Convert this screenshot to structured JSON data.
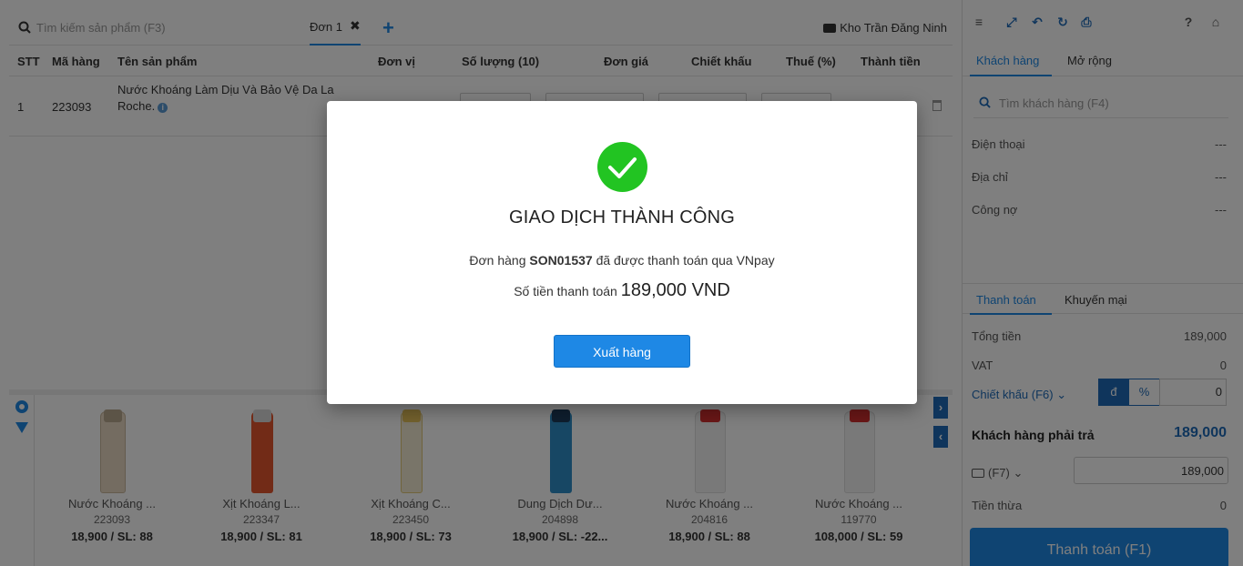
{
  "search": {
    "placeholder": "Tìm kiếm sản phẩm (F3)"
  },
  "order_tab": {
    "label": "Đơn 1",
    "close": "✖",
    "add": "+"
  },
  "warehouse": "Kho Trần Đăng Ninh",
  "table": {
    "headers": [
      "STT",
      "Mã hàng",
      "Tên sản phẩm",
      "Đơn vị",
      "Số lượng (10)",
      "Đơn giá",
      "Chiết khấu",
      "Thuế (%)",
      "Thành tiền"
    ],
    "rows": [
      {
        "stt": "1",
        "code": "223093",
        "name_line1": "Nước Khoáng Làm Dịu Và Bảo Vệ Da La",
        "name_line2": "Roche."
      }
    ]
  },
  "products": [
    {
      "name": "Nước Khoáng ...",
      "code": "223093",
      "price": "18,900 / SL: 88"
    },
    {
      "name": "Xịt Khoáng L...",
      "code": "223347",
      "price": "18,900 / SL: 81"
    },
    {
      "name": "Xịt Khoáng C...",
      "code": "223450",
      "price": "18,900 / SL: 73"
    },
    {
      "name": "Dung Dịch Dư...",
      "code": "204898",
      "price": "18,900 / SL: -22..."
    },
    {
      "name": "Nước Khoáng ...",
      "code": "204816",
      "price": "18,900 / SL: 88"
    },
    {
      "name": "Nước Khoáng ...",
      "code": "119770",
      "price": "108,000 / SL: 59"
    }
  ],
  "right_panel": {
    "tabs": {
      "customer": "Khách hàng",
      "more": "Mở rộng"
    },
    "customer_search_placeholder": "Tìm khách hàng (F4)",
    "phone_label": "Điện thoại",
    "phone_value": "---",
    "address_label": "Địa chỉ",
    "address_value": "---",
    "debt_label": "Công nợ",
    "debt_value": "---",
    "pay_tabs": {
      "payment": "Thanh toán",
      "promo": "Khuyến mại"
    },
    "total_label": "Tổng tiền",
    "total_value": "189,000",
    "vat_label": "VAT",
    "vat_value": "0",
    "discount_label": "Chiết khấu (F6)",
    "discount_unit_vnd": "đ",
    "discount_unit_pct": "%",
    "discount_value": "0",
    "due_label": "Khách hàng phải trả",
    "due_value": "189,000",
    "method_label": "(F7)",
    "paid_value": "189,000",
    "change_label": "Tiền thừa",
    "change_value": "0",
    "pay_button": "Thanh toán (F1)"
  },
  "modal": {
    "title": "GIAO DỊCH THÀNH CÔNG",
    "msg_prefix": "Đơn hàng",
    "order_code": "SON01537",
    "msg_suffix": "đã được thanh toán qua VNpay",
    "amount_prefix": "Số tiền thanh toán",
    "amount": "189,000 VND",
    "button": "Xuất hàng"
  },
  "colors": {
    "accent": "#1e88e5",
    "success": "#22c422"
  }
}
